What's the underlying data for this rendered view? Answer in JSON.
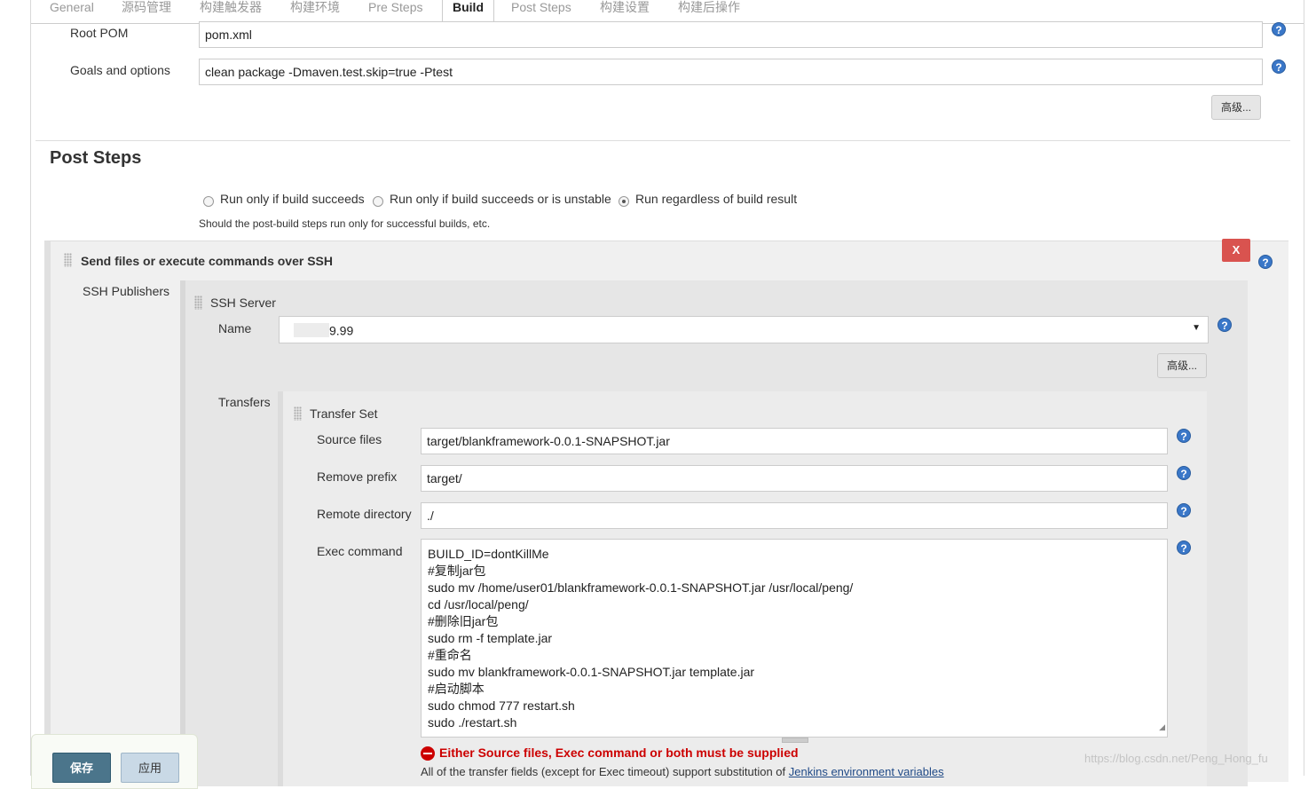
{
  "tabs": [
    "General",
    "源码管理",
    "构建触发器",
    "构建环境",
    "Pre Steps",
    "Build",
    "Post Steps",
    "构建设置",
    "构建后操作"
  ],
  "active_tab": "Build",
  "build": {
    "root_pom_label": "Root POM",
    "root_pom_value": "pom.xml",
    "goals_label": "Goals and options",
    "goals_value": "clean package -Dmaven.test.skip=true -Ptest",
    "advanced_label": "高级..."
  },
  "post_steps": {
    "title": "Post Steps",
    "radio_options": [
      "Run only if build succeeds",
      "Run only if build succeeds or is unstable",
      "Run regardless of build result"
    ],
    "selected": "Run regardless of build result",
    "hint": "Should the post-build steps run only for successful builds, etc."
  },
  "ssh": {
    "section_title": "Send files or execute commands over SSH",
    "delete_label": "X",
    "publishers_label": "SSH Publishers",
    "server_title": "SSH Server",
    "name_label": "Name",
    "name_value": "9.99",
    "advanced_label": "高级...",
    "transfers_label": "Transfers",
    "transfer_set_title": "Transfer Set",
    "source_files_label": "Source files",
    "source_files_value": "target/blankframework-0.0.1-SNAPSHOT.jar",
    "remove_prefix_label": "Remove prefix",
    "remove_prefix_value": "target/",
    "remote_dir_label": "Remote directory",
    "remote_dir_value": "./",
    "exec_label": "Exec command",
    "exec_lines": [
      "BUILD_ID=dontKillMe",
      "#复制jar包",
      "sudo mv /home/user01/blankframework-0.0.1-SNAPSHOT.jar /usr/local/peng/",
      "cd /usr/local/peng/",
      "#删除旧jar包",
      "sudo rm -f template.jar",
      "#重命名",
      "sudo mv blankframework-0.0.1-SNAPSHOT.jar template.jar",
      "#启动脚本",
      "sudo chmod 777 restart.sh",
      "sudo ./restart.sh"
    ],
    "error_text": "Either Source files, Exec command or both must be supplied",
    "footnote_text": "All of the transfer fields (except for Exec timeout) support substitution of",
    "footnote_link": "Jenkins environment variables"
  },
  "footer": {
    "save_label": "保存",
    "apply_label": "应用"
  },
  "watermark": "https://blog.csdn.net/Peng_Hong_fu",
  "colors": {
    "help_icon": "#3a77c8",
    "delete_button": "#d9534f",
    "error_text": "#cc0000",
    "save_button": "#4b758b",
    "apply_button": "#c9d9e6"
  }
}
